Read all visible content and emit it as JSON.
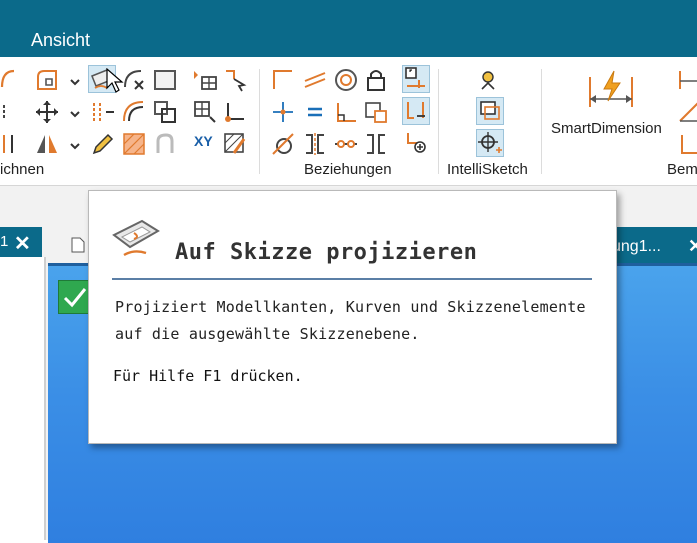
{
  "menubar": {
    "item": "Ansicht"
  },
  "ribbon": {
    "groups": {
      "zeichnen": "ichnen",
      "beziehungen": "Beziehungen",
      "intellisketch": "IntelliSketch",
      "bemassung": "Bem"
    },
    "smartdimension_label": "SmartDimension",
    "xy_label": "XY"
  },
  "tabs": {
    "left_number": "1",
    "right_label": "ung1...",
    "close_glyph": "✕"
  },
  "tooltip": {
    "title": "Auf Skizze projizieren",
    "description_lines": [
      "Projiziert Modellkanten, Kurven und Skizzenelemente",
      "auf die ausgewählte Skizzenebene."
    ],
    "help": "Für Hilfe F1 drücken."
  },
  "colors": {
    "titlebar": "#0b6a8a",
    "viewport": "#3b8fe6",
    "accent_orange": "#e07a2e",
    "check_green": "#2fa84f"
  }
}
